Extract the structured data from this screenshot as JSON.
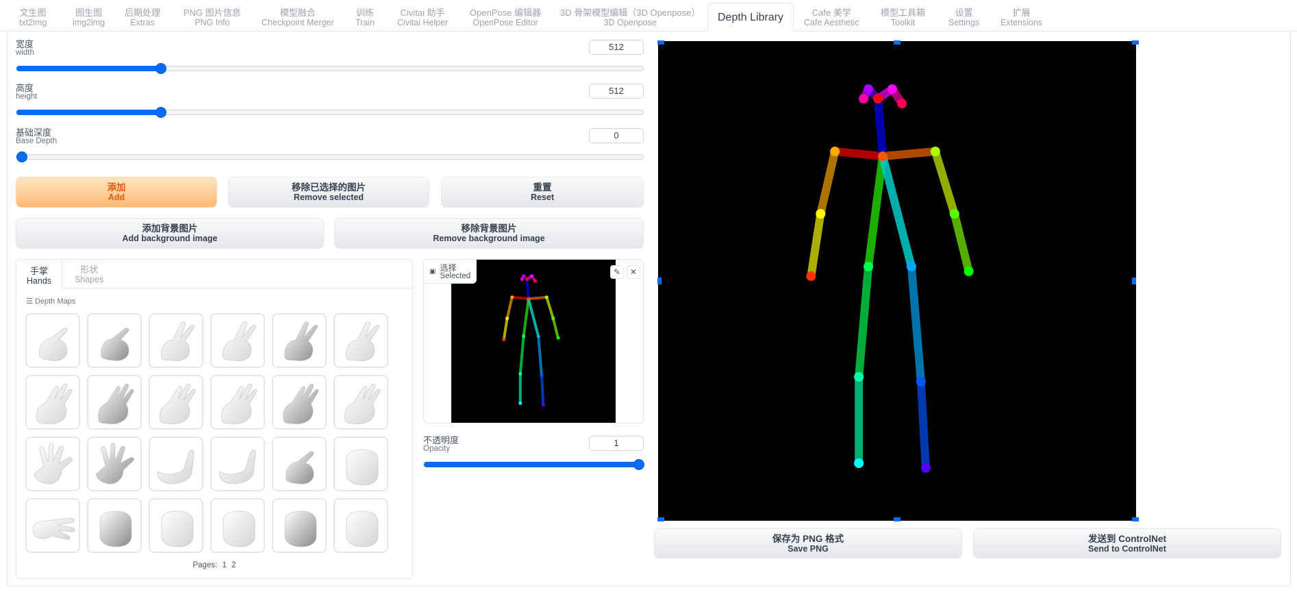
{
  "tabs": [
    {
      "label": "文生图",
      "sub": "txt2img"
    },
    {
      "label": "图生图",
      "sub": "img2img"
    },
    {
      "label": "后期处理",
      "sub": "Extras"
    },
    {
      "label": "PNG 图片信息",
      "sub": "PNG Info"
    },
    {
      "label": "模型融合",
      "sub": "Checkpoint Merger"
    },
    {
      "label": "训练",
      "sub": "Train"
    },
    {
      "label": "Civitai 助手",
      "sub": "Civitai Helper"
    },
    {
      "label": "OpenPose 编辑器",
      "sub": "OpenPose Editor"
    },
    {
      "label": "3D 骨架模型编辑（3D Openpose）",
      "sub": "3D Openpose"
    },
    {
      "label": "Depth Library",
      "sub": ""
    },
    {
      "label": "Cafe 美学",
      "sub": "Cafe Aesthetic"
    },
    {
      "label": "模型工具箱",
      "sub": "Toolkit"
    },
    {
      "label": "设置",
      "sub": "Settings"
    },
    {
      "label": "扩展",
      "sub": "Extensions"
    }
  ],
  "active_tab": "Depth Library",
  "sliders": {
    "width": {
      "label": "宽度",
      "sub": "width",
      "value": "512",
      "fraction": 0.23
    },
    "height": {
      "label": "高度",
      "sub": "height",
      "value": "512",
      "fraction": 0.23
    },
    "base_depth": {
      "label": "基础深度",
      "sub": "Base Depth",
      "value": "0",
      "fraction": 0.0
    },
    "opacity": {
      "label": "不透明度",
      "sub": "Opacity",
      "value": "1",
      "fraction": 1.0
    }
  },
  "buttons": {
    "add": {
      "label": "添加",
      "sub": "Add"
    },
    "remove_selected": {
      "label": "移除已选择的图片",
      "sub": "Remove selected"
    },
    "reset": {
      "label": "重置",
      "sub": "Reset"
    },
    "add_bg": {
      "label": "添加背景图片",
      "sub": "Add background image"
    },
    "remove_bg": {
      "label": "移除背景图片",
      "sub": "Remove background image"
    },
    "save_png": {
      "label": "保存为 PNG 格式",
      "sub": "Save PNG"
    },
    "send_controlnet": {
      "label": "发送到 ControlNet",
      "sub": "Send to ControlNet"
    }
  },
  "library": {
    "tabs": [
      {
        "label": "手掌",
        "sub": "Hands"
      },
      {
        "label": "形状",
        "sub": "Shapes"
      }
    ],
    "section_label": "Depth Maps",
    "items": [
      "hand-point-icon",
      "hand-point-icon",
      "hand-peace-icon",
      "hand-peace-icon",
      "hand-peace-icon",
      "hand-peace-icon",
      "hand-open-icon",
      "hand-open-icon",
      "hand-open-icon",
      "hand-open-icon",
      "hand-open-icon",
      "hand-open-icon",
      "hand-spread-icon",
      "hand-spread-icon",
      "hand-cup-icon",
      "hand-cup-icon",
      "hand-point-icon",
      "hand-fist-icon",
      "hand-flat-icon",
      "hand-fist-icon",
      "hand-fist-icon",
      "hand-fist-icon",
      "hand-fist-icon",
      "hand-fist-icon"
    ],
    "pages_label": "Pages:",
    "pages": [
      "1",
      "2"
    ]
  },
  "selected": {
    "label": "选择",
    "sub": "Selected",
    "edit_icon": "pencil-icon",
    "close_icon": "close-icon"
  },
  "skeleton": {
    "joints": [
      [
        0.46,
        0.12
      ],
      [
        0.47,
        0.24
      ],
      [
        0.37,
        0.23
      ],
      [
        0.34,
        0.36
      ],
      [
        0.32,
        0.49
      ],
      [
        0.58,
        0.23
      ],
      [
        0.62,
        0.36
      ],
      [
        0.65,
        0.48
      ],
      [
        0.44,
        0.47
      ],
      [
        0.42,
        0.7
      ],
      [
        0.42,
        0.88
      ],
      [
        0.53,
        0.47
      ],
      [
        0.55,
        0.71
      ],
      [
        0.56,
        0.89
      ],
      [
        0.44,
        0.1
      ],
      [
        0.49,
        0.1
      ],
      [
        0.43,
        0.12
      ],
      [
        0.51,
        0.13
      ]
    ],
    "limbs": [
      [
        1,
        2,
        "#cc0000"
      ],
      [
        1,
        5,
        "#cc5500"
      ],
      [
        2,
        3,
        "#cc8800"
      ],
      [
        3,
        4,
        "#cccc00"
      ],
      [
        5,
        6,
        "#aacc00"
      ],
      [
        6,
        7,
        "#66cc00"
      ],
      [
        1,
        8,
        "#22cc00"
      ],
      [
        8,
        9,
        "#00cc44"
      ],
      [
        9,
        10,
        "#00cc88"
      ],
      [
        1,
        11,
        "#00cccc"
      ],
      [
        11,
        12,
        "#0088cc"
      ],
      [
        12,
        13,
        "#0044cc"
      ],
      [
        0,
        1,
        "#0000cc"
      ],
      [
        0,
        14,
        "#5500cc"
      ],
      [
        14,
        16,
        "#aa00cc"
      ],
      [
        0,
        15,
        "#cc00cc"
      ],
      [
        15,
        17,
        "#cc0088"
      ]
    ],
    "joint_colors": [
      "#ff0000",
      "#ff5500",
      "#ffaa00",
      "#ffff00",
      "#ff3300",
      "#aaff00",
      "#55ff00",
      "#00ff00",
      "#00ff55",
      "#00ffaa",
      "#00ffff",
      "#00aaff",
      "#0055ff",
      "#5500ff",
      "#aa00ff",
      "#ff00ff",
      "#ff00aa",
      "#ff0055"
    ]
  }
}
